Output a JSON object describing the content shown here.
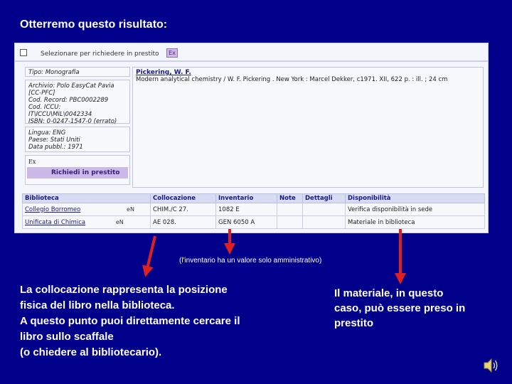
{
  "slide": {
    "title": "Otterremo questo risultato:",
    "note": "(l'inventario ha un valore solo amministrativo)",
    "left_caption": [
      "La collocazione rappresenta la posizione",
      "fisica del libro nella biblioteca.",
      "A questo punto puoi direttamente cercare il",
      "libro sullo scaffale",
      "(o chiedere al bibliotecario)."
    ],
    "right_caption": [
      "Il materiale, in questo",
      "caso, può essere preso in",
      "prestito"
    ],
    "arrow_color": "#E02020"
  },
  "toolbar": {
    "select_label": "Selezionare per richiedere in prestito",
    "ex_icon": "Ex"
  },
  "record": {
    "tipo": "Tipo: Monografia",
    "archive_lines": [
      "Archivio: Polo EasyCat Pavia",
      "            [CC-PFC]",
      "Cod. Record: PBC0002289",
      "Cod. ICCU:",
      "IT\\ICCU\\MIL\\0042334",
      "ISBN: 0-0247-1547-0 (errato)"
    ],
    "lang_lines": [
      "Lingua: ENG",
      "Paese: Stati Uniti",
      "Data pubbl.: 1971"
    ],
    "fx_label": "Ex",
    "request_label": "Richiedi in prestito",
    "author": "Pickering, W. F.",
    "citation": "Modern analytical chemistry / W. F. Pickering .   New York : Marcel Dekker, c1971.   XII, 622 p. : ill. ; 24 cm"
  },
  "holdings": {
    "headers": [
      "Biblioteca",
      "Collocazione",
      "Inventario",
      "Note",
      "Dettagli",
      "Disponibilità"
    ],
    "rows": [
      {
        "biblioteca": "Collegio Borromeo",
        "icon": "eN",
        "collocazione": "CHIM./C 27.",
        "inventario": "1082 E",
        "note": "",
        "dettagli": "",
        "disponibilita": "Verifica disponibilità in sede"
      },
      {
        "biblioteca": "Unificata di Chimica",
        "icon": "eN",
        "collocazione": "AE 028.",
        "inventario": "GEN 6050 A",
        "note": "",
        "dettagli": "",
        "disponibilita": "Materiale in biblioteca"
      }
    ]
  }
}
